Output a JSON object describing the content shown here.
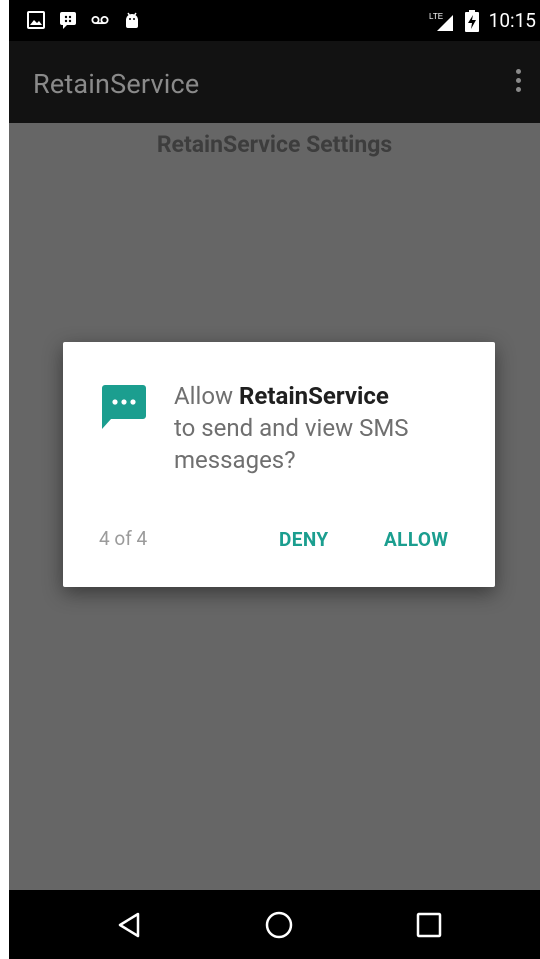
{
  "status_bar": {
    "time": "10:15",
    "network": "LTE",
    "icons_left": [
      "image-notification-icon",
      "blackberry-messenger-icon",
      "voicemail-icon",
      "android-icon"
    ],
    "icons_right": [
      "signal-icon",
      "battery-charging-icon"
    ]
  },
  "app_bar": {
    "title": "RetainService",
    "overflow_icon": "overflow-menu-icon"
  },
  "content": {
    "heading": "RetainService Settings"
  },
  "dialog": {
    "icon": "sms-icon",
    "message_prefix": "Allow ",
    "app_name": "RetainService",
    "message_suffix": "to send and view SMS messages?",
    "counter": "4 of 4",
    "deny_label": "DENY",
    "allow_label": "ALLOW",
    "accent_color": "#1b9e8f"
  },
  "nav_bar": {
    "back": "back-icon",
    "home": "home-icon",
    "recents": "recents-icon"
  }
}
